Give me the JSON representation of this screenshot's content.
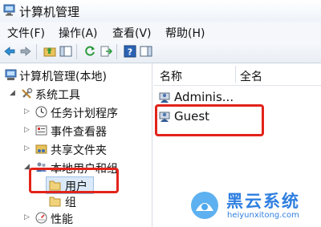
{
  "window": {
    "title": "计算机管理"
  },
  "menu": [
    "文件(F)",
    "操作(A)",
    "查看(V)",
    "帮助(H)"
  ],
  "tree": {
    "root": "计算机管理(本地)",
    "system_tools": "系统工具",
    "task_scheduler": "任务计划程序",
    "event_viewer": "事件查看器",
    "shared_folders": "共享文件夹",
    "local_users": "本地用户和组",
    "users": "用户",
    "groups": "组",
    "performance": "性能"
  },
  "list": {
    "columns": [
      "名称",
      "全名"
    ],
    "items": [
      {
        "name": "Adminis...",
        "fullname": ""
      },
      {
        "name": "Guest",
        "fullname": ""
      }
    ]
  },
  "watermark": {
    "title": "黑云系统",
    "url": "heiyunxitong.com"
  },
  "colors": {
    "highlight": "#e2231a",
    "accent": "#2f7fe0"
  }
}
